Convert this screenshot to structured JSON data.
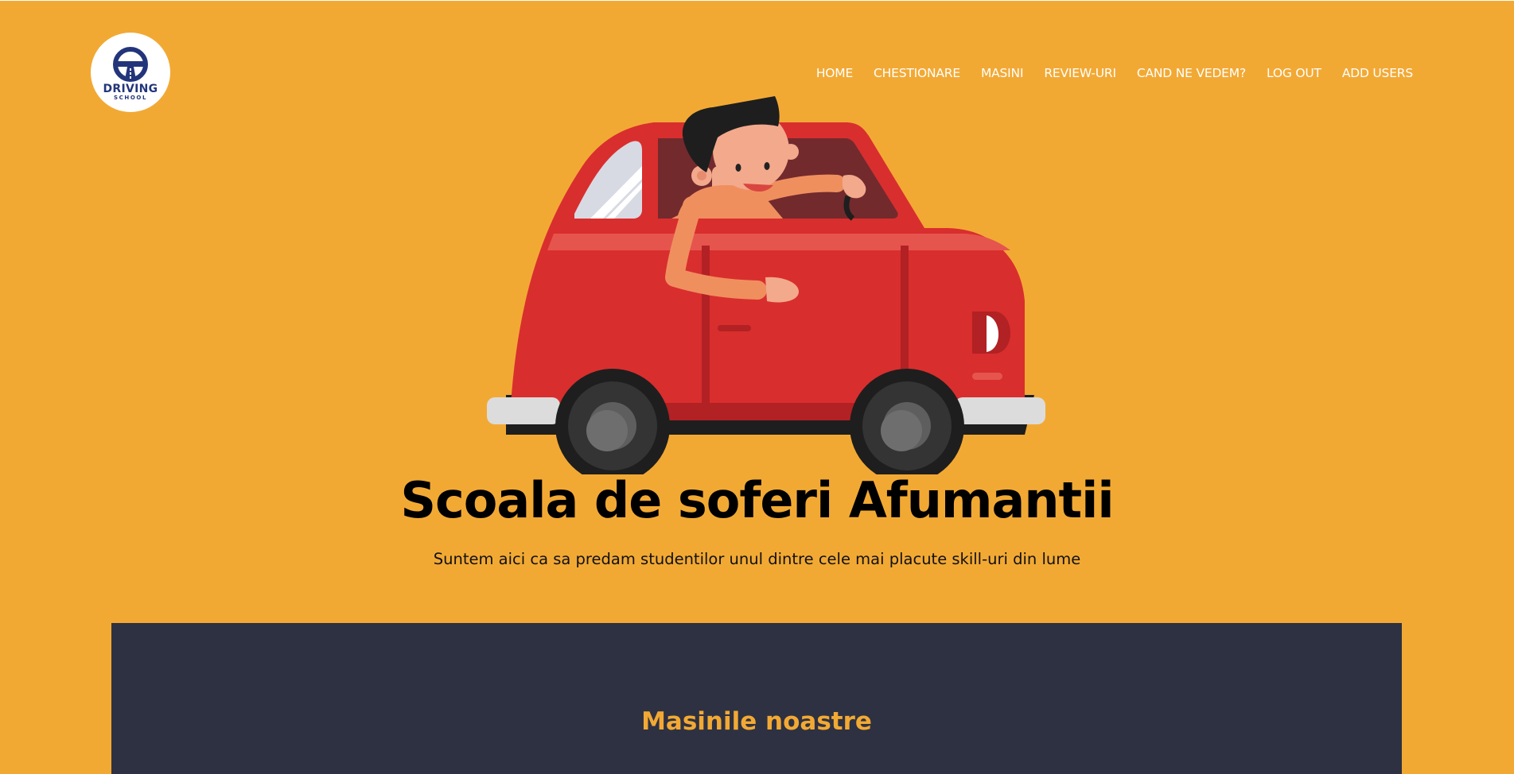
{
  "logo": {
    "text": "DRIVING",
    "subtext": "SCHOOL",
    "icon": "steering-wheel-icon",
    "color": "#23357a"
  },
  "nav": {
    "items": [
      {
        "label": "HOME"
      },
      {
        "label": "CHESTIONARE"
      },
      {
        "label": "MASINI"
      },
      {
        "label": "REVIEW-URI"
      },
      {
        "label": "CAND NE VEDEM?"
      },
      {
        "label": "LOG OUT"
      },
      {
        "label": "ADD USERS"
      }
    ]
  },
  "hero": {
    "image": "cartoon-driver-in-red-car",
    "title": "Scoala de soferi Afumantii",
    "subtitle": "Suntem aici ca sa predam studentilor unul dintre cele mai placute skill-uri din lume"
  },
  "cars_section": {
    "title": "Masinile noastre"
  },
  "colors": {
    "background": "#f2a934",
    "section_background": "#2e3141",
    "accent": "#f2a934",
    "car_red": "#d92e2e"
  }
}
